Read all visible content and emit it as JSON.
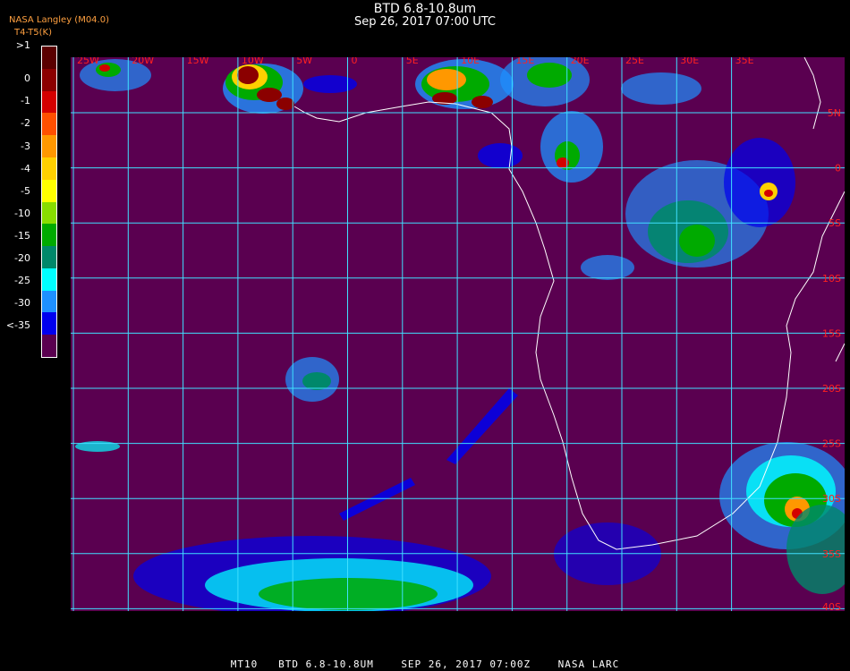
{
  "header": {
    "title": "BTD 6.8-10.8um",
    "date": "Sep 26, 2017 07:00 UTC",
    "corner_line1": "NASA Langley (M04.0)",
    "corner_line2": "T4-T5(K)",
    "corner_overlay": "BTD"
  },
  "colorbar": {
    "labels": [
      ">1",
      "0",
      "-1",
      "-2",
      "-3",
      "-4",
      "-5",
      "-10",
      "-15",
      "-20",
      "-25",
      "-30",
      "<-35"
    ],
    "colors": [
      "#5a0000",
      "#8b0000",
      "#d40000",
      "#ff5000",
      "#ff9800",
      "#ffd000",
      "#ffff00",
      "#88dd00",
      "#00aa00",
      "#00886a",
      "#00ffff",
      "#1e90ff",
      "#0000ee",
      "#5a0050"
    ]
  },
  "map": {
    "background": "#5a0050",
    "grid_color": "#40e0ff",
    "label_color": "#ff2020",
    "coast_color": "#ffffff",
    "lon_labels": [
      "25W",
      "20W",
      "15W",
      "10W",
      "5W",
      "0",
      "5E",
      "10E",
      "15E",
      "20E",
      "25E",
      "30E",
      "35E"
    ],
    "lat_labels": [
      "5N",
      "0",
      "5S",
      "10S",
      "15S",
      "20S",
      "25S",
      "30S",
      "35S",
      "40S"
    ]
  },
  "footer": "MT10   BTD 6.8-10.8UM    SEP 26, 2017 07:00Z    NASA LARC"
}
